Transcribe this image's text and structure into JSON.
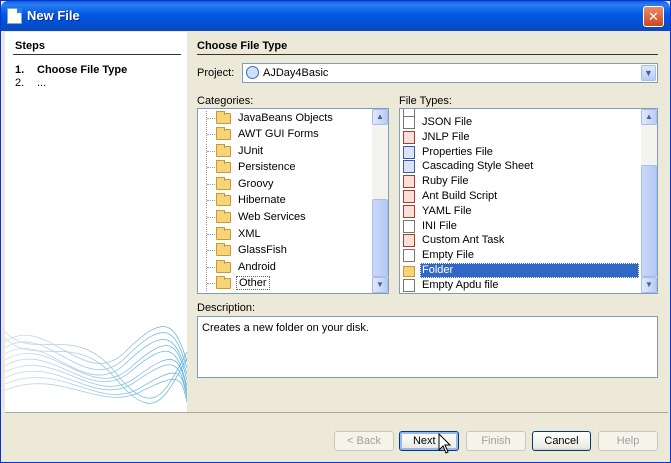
{
  "window": {
    "title": "New File",
    "close_glyph": "✕"
  },
  "steps": {
    "heading": "Steps",
    "items": [
      {
        "num": "1.",
        "label": "Choose File Type"
      },
      {
        "num": "2.",
        "label": "..."
      }
    ]
  },
  "main": {
    "heading": "Choose File Type",
    "project_label": "Project:",
    "project_value": "AJDay4Basic",
    "categories_label": "Categories:",
    "file_types_label": "File Types:",
    "categories": [
      "JavaBeans Objects",
      "AWT GUI Forms",
      "JUnit",
      "Persistence",
      "Groovy",
      "Hibernate",
      "Web Services",
      "XML",
      "GlassFish",
      "Android",
      "Other"
    ],
    "selected_category": "Other",
    "file_types": [
      {
        "label": "JSON File",
        "icon": "file-icon"
      },
      {
        "label": "JNLP File",
        "icon": "jnlp-icon"
      },
      {
        "label": "Properties File",
        "icon": "properties-icon"
      },
      {
        "label": "Cascading Style Sheet",
        "icon": "css-icon"
      },
      {
        "label": "Ruby File",
        "icon": "ruby-icon"
      },
      {
        "label": "Ant Build Script",
        "icon": "ant-icon"
      },
      {
        "label": "YAML File",
        "icon": "yaml-icon"
      },
      {
        "label": "INI File",
        "icon": "ini-icon"
      },
      {
        "label": "Custom Ant Task",
        "icon": "ant-task-icon"
      },
      {
        "label": "Empty File",
        "icon": "file-icon"
      },
      {
        "label": "Folder",
        "icon": "folder-icon"
      },
      {
        "label": "Empty Apdu file",
        "icon": "apdu-icon"
      }
    ],
    "selected_file_type": "Folder",
    "description_label": "Description:",
    "description": "Creates a new folder on your disk."
  },
  "buttons": {
    "back": "< Back",
    "next": "Next >",
    "finish": "Finish",
    "cancel": "Cancel",
    "help": "Help"
  },
  "colors": {
    "title_bar": "#0058e6",
    "selection": "#3168c5",
    "dialog_bg": "#ece9d8"
  }
}
